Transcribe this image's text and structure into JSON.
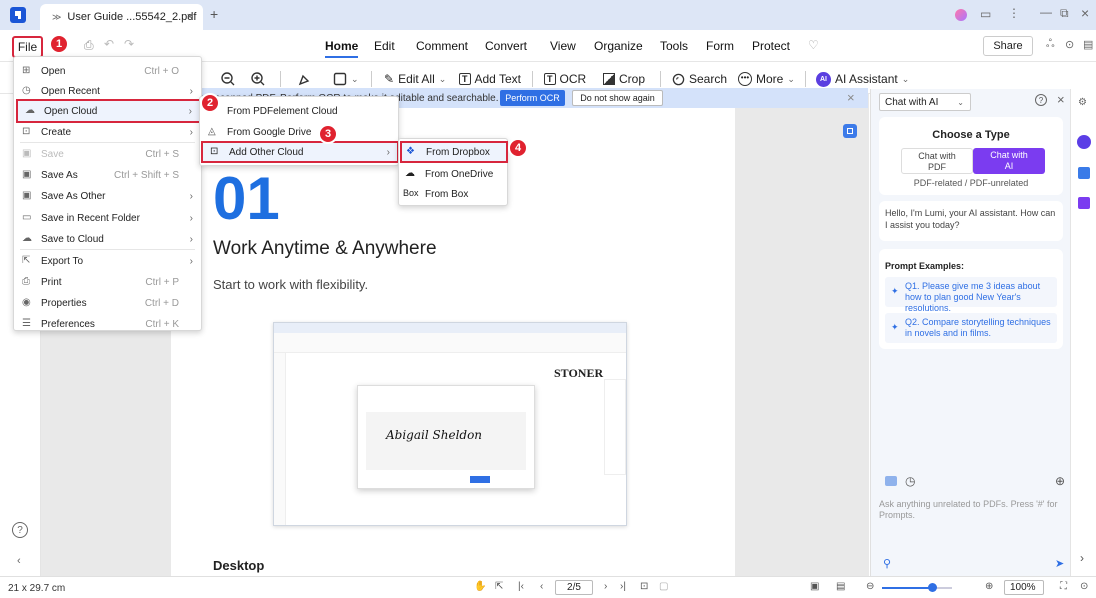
{
  "window": {
    "tab_title": "User Guide ...55542_2.pdf",
    "plus": "+"
  },
  "menubar": {
    "file": "File",
    "items": [
      "Home",
      "Edit",
      "Comment",
      "Convert",
      "View",
      "Organize",
      "Tools",
      "Form",
      "Protect"
    ],
    "active": "Home",
    "share": "Share"
  },
  "toolbar": {
    "edit_all": "Edit All",
    "add_text": "Add Text",
    "ocr": "OCR",
    "crop": "Crop",
    "search": "Search",
    "more": "More",
    "ai_assistant": "AI Assistant",
    "ai_badge": "AI"
  },
  "banner": {
    "text": "This is a scanned PDF. Perform OCR to make it editable and searchable.",
    "perform_ocr": "Perform OCR",
    "do_not_show": "Do not show again"
  },
  "file_menu": {
    "items": [
      {
        "label": "Open",
        "shortcut": "Ctrl + O",
        "arrow": false,
        "icon": "open-icon"
      },
      {
        "label": "Open Recent",
        "shortcut": "",
        "arrow": true,
        "icon": "clock-icon"
      },
      {
        "label": "Open Cloud",
        "shortcut": "",
        "arrow": true,
        "icon": "cloud-icon"
      },
      {
        "label": "Create",
        "shortcut": "",
        "arrow": true,
        "icon": "create-icon"
      },
      {
        "label": "Save",
        "shortcut": "Ctrl + S",
        "arrow": false,
        "icon": "save-icon",
        "disabled": true
      },
      {
        "label": "Save As",
        "shortcut": "Ctrl + Shift + S",
        "arrow": false,
        "icon": "save-as-icon"
      },
      {
        "label": "Save As Other",
        "shortcut": "",
        "arrow": true,
        "icon": "save-other-icon"
      },
      {
        "label": "Save in Recent Folder",
        "shortcut": "",
        "arrow": true,
        "icon": "folder-icon"
      },
      {
        "label": "Save to Cloud",
        "shortcut": "",
        "arrow": true,
        "icon": "cloud-upload-icon"
      },
      {
        "label": "Export To",
        "shortcut": "",
        "arrow": true,
        "icon": "export-icon"
      },
      {
        "label": "Print",
        "shortcut": "Ctrl + P",
        "arrow": false,
        "icon": "print-icon"
      },
      {
        "label": "Properties",
        "shortcut": "Ctrl + D",
        "arrow": false,
        "icon": "properties-icon"
      },
      {
        "label": "Preferences",
        "shortcut": "Ctrl + K",
        "arrow": false,
        "icon": "preferences-icon"
      }
    ]
  },
  "cloud_menu": {
    "items": [
      "From PDFelement Cloud",
      "From Google Drive",
      "Add Other Cloud"
    ]
  },
  "other_cloud_menu": {
    "items": [
      "From Dropbox",
      "From OneDrive",
      "From Box"
    ],
    "box_prefix": "Box"
  },
  "steps": [
    "1",
    "2",
    "3",
    "4"
  ],
  "document": {
    "number": "01",
    "heading": "Work Anytime & Anywhere",
    "subheading": "Start to work with flexibility.",
    "desktop": "Desktop",
    "shot_brand": "STONER",
    "shot_signature": "Abigail Sheldon"
  },
  "ai_panel": {
    "mode": "Chat with AI",
    "choose_type": "Choose a Type",
    "chat_pdf": "Chat with PDF",
    "chat_ai": "Chat with AI",
    "type_note": "PDF-related / PDF-unrelated",
    "greeting": "Hello, I'm Lumi, your AI assistant. How can I assist you today?",
    "prompt_examples": "Prompt Examples:",
    "q1": "Q1. Please give me 3 ideas about how to plan good New Year's resolutions.",
    "q2": "Q2. Compare storytelling techniques in novels and in films.",
    "input_placeholder": "Ask anything unrelated to PDFs. Press '#' for Prompts."
  },
  "status": {
    "size": "21 x 29.7 cm",
    "page": "2/5",
    "zoom": "100%"
  },
  "colors": {
    "accent": "#2f6fe4",
    "step_red": "#e0222f",
    "ai_purple": "#7b3cf0"
  }
}
